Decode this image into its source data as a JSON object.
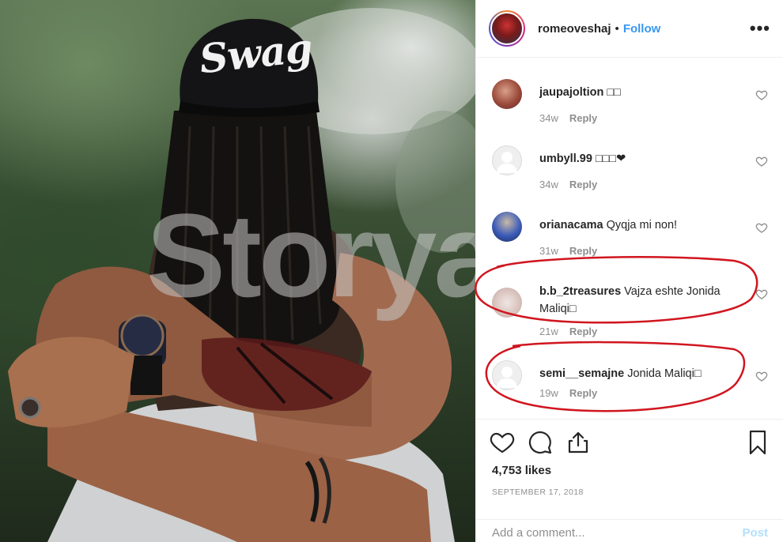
{
  "photo": {
    "cap_text": "Swag",
    "watermark": "Storyal"
  },
  "header": {
    "username": "romeoveshaj",
    "separator": "•",
    "follow_label": "Follow",
    "more_icon": "more-horizontal-icon"
  },
  "comments": [
    {
      "username": "jaupajoltion",
      "text": "□□",
      "age": "34w",
      "reply": "Reply",
      "avatar": "photo"
    },
    {
      "username": "umbyll.99",
      "text": "□□□❤",
      "age": "34w",
      "reply": "Reply",
      "avatar": "blank"
    },
    {
      "username": "orianacama",
      "text": "Qyqja mi non!",
      "age": "31w",
      "reply": "Reply",
      "avatar": "photo"
    },
    {
      "username": "b.b_2treasures",
      "text": "Vajza eshte Jonida Maliqi□",
      "age": "21w",
      "reply": "Reply",
      "avatar": "photo"
    },
    {
      "username": "semi__semajne",
      "text": "Jonida Maliqi□",
      "age": "19w",
      "reply": "Reply",
      "avatar": "blank"
    }
  ],
  "actions": {
    "likes": "4,753 likes",
    "date": "SEPTEMBER 17, 2018",
    "add_comment_placeholder": "Add a comment...",
    "post_label": "Post"
  },
  "colors": {
    "accent": "#3897f0",
    "highlight_ring": "#d0161f",
    "muted": "#8e8e8e"
  }
}
